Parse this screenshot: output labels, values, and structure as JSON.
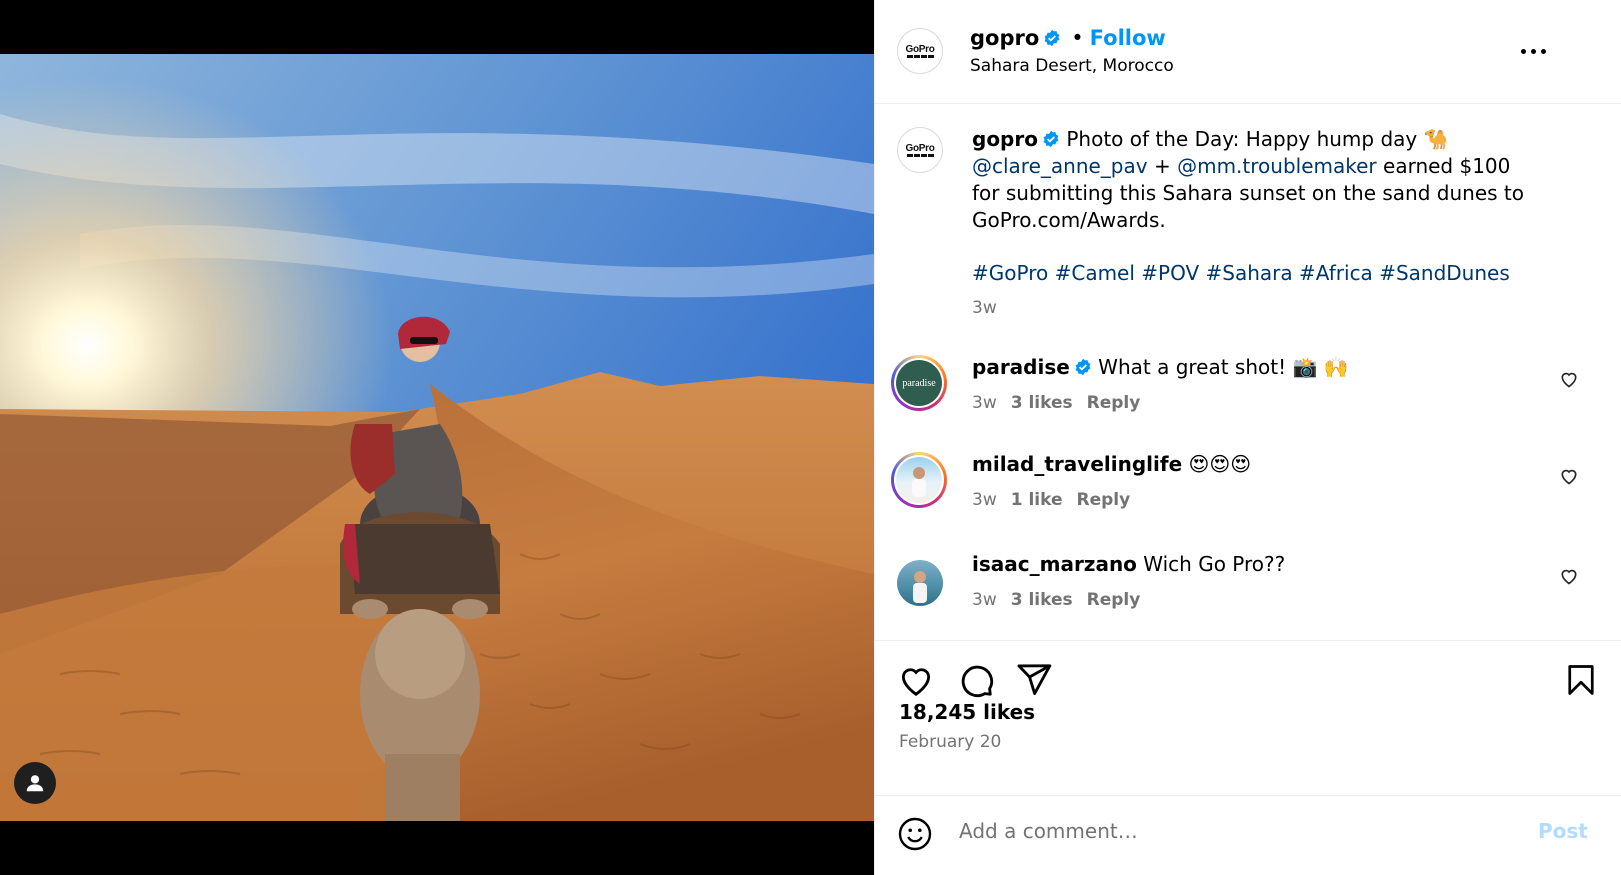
{
  "post": {
    "username": "gopro",
    "follow_label": "Follow",
    "separator": "•",
    "location": "Sahara Desert, Morocco",
    "avatar_text": "GoPro"
  },
  "caption": {
    "username": "gopro",
    "text_lead": "Photo of the Day: Happy hump day 🐪",
    "mention1": "@clare_anne_pav",
    "joiner": " + ",
    "mention2": "@mm.troublemaker",
    "text_rest": " earned $100 for submitting this Sahara sunset on the sand dunes to GoPro.com/Awards.",
    "hashtags": [
      "#GoPro",
      "#Camel",
      "#POV",
      "#Sahara",
      "#Africa",
      "#SandDunes"
    ],
    "time": "3w"
  },
  "comments": [
    {
      "username": "paradise",
      "verified": true,
      "text": "What a great shot! 📸 🙌",
      "time": "3w",
      "likes": "3 likes",
      "reply": "Reply",
      "avatar_text": "paradise"
    },
    {
      "username": "milad_travelinglife",
      "verified": false,
      "text": "😍😍😍",
      "time": "3w",
      "likes": "1 like",
      "reply": "Reply"
    },
    {
      "username": "isaac_marzano",
      "verified": false,
      "text": "Wich Go Pro??",
      "time": "3w",
      "likes": "3 likes",
      "reply": "Reply"
    }
  ],
  "stats": {
    "likes": "18,245 likes",
    "date": "February 20"
  },
  "composer": {
    "placeholder": "Add a comment…",
    "post_label": "Post"
  },
  "colors": {
    "accent": "#0095f6",
    "link": "#00376b",
    "muted": "#737373",
    "verified": "#0095f6"
  },
  "icons": [
    "user-tag-icon",
    "more-options-icon",
    "verified-icon",
    "heart-icon",
    "comment-icon",
    "share-icon",
    "bookmark-icon",
    "emoji-icon"
  ]
}
